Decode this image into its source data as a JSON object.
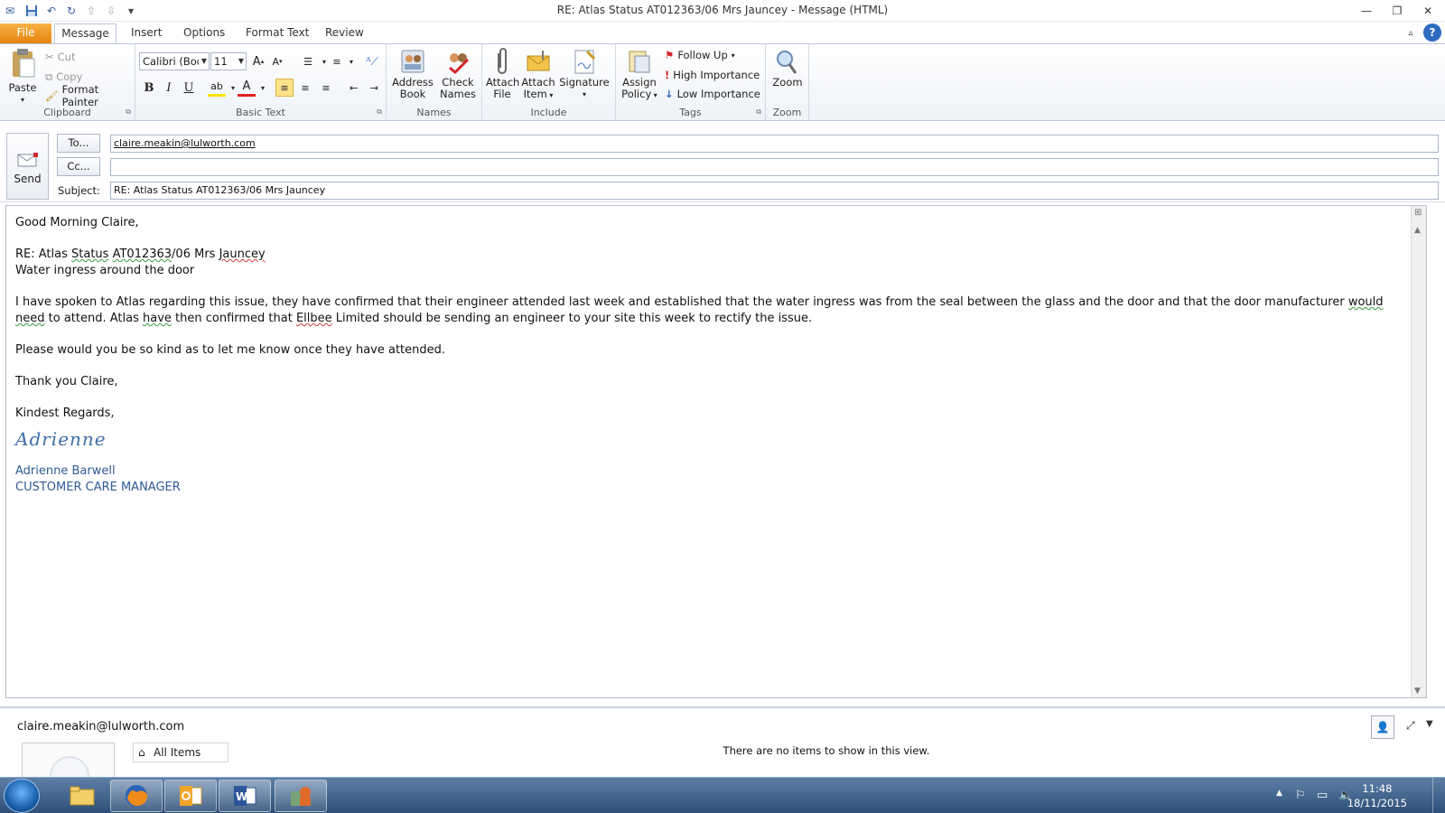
{
  "window": {
    "title": "RE: Atlas Status  AT012363/06  Mrs Jauncey  -  Message (HTML)"
  },
  "tabs": [
    "File",
    "Message",
    "Insert",
    "Options",
    "Format Text",
    "Review"
  ],
  "ribbon": {
    "clipboard": {
      "label": "Clipboard",
      "paste": "Paste",
      "cut": "Cut",
      "copy": "Copy",
      "format_painter": "Format Painter"
    },
    "basic_text": {
      "label": "Basic Text",
      "font": "Calibri (Body)",
      "size": "11"
    },
    "names": {
      "label": "Names",
      "address_book_1": "Address",
      "address_book_2": "Book",
      "check_names_1": "Check",
      "check_names_2": "Names"
    },
    "include": {
      "label": "Include",
      "attach_file_1": "Attach",
      "attach_file_2": "File",
      "attach_item_1": "Attach",
      "attach_item_2": "Item",
      "signature": "Signature"
    },
    "tags": {
      "label": "Tags",
      "assign_1": "Assign",
      "assign_2": "Policy",
      "follow_up": "Follow Up",
      "high": "High Importance",
      "low": "Low Importance"
    },
    "zoom": {
      "label": "Zoom",
      "zoom": "Zoom"
    }
  },
  "header": {
    "send": "Send",
    "to_button": "To...",
    "cc_button": "Cc...",
    "subject_label": "Subject:",
    "to_value": "claire.meakin@lulworth.com",
    "cc_value": "",
    "subject_value": "RE: Atlas Status  AT012363/06  Mrs Jauncey"
  },
  "body": {
    "greeting": "Good Morning Claire,",
    "ref_prefix": "RE: Atlas ",
    "ref_status": "Status",
    "ref_space": " ",
    "ref_code": "AT012363",
    "ref_suffix": "/06  Mrs ",
    "ref_name": "Jauncey",
    "ref_line2": "Water ingress around the door",
    "para1_a": "I have spoken to Atlas regarding this issue, they have confirmed that their engineer attended last week and established that the water ingress was from the seal between the glass and the door and that the door manufacturer ",
    "para1_would": "would  need",
    "para1_b": " to attend.  Atlas ",
    "para1_have": "have",
    "para1_c": " then confirmed that ",
    "para1_ellbee": "Ellbee",
    "para1_d": " Limited should be sending an engineer to your site this week to rectify the issue.",
    "para2": "Please would you be so kind as to let me know once they have attended.",
    "thanks": "Thank you Claire,",
    "regards": "Kindest Regards,",
    "sig_script": "Adrienne",
    "sig_name": "Adrienne Barwell",
    "sig_title": "CUSTOMER CARE MANAGER"
  },
  "people_pane": {
    "address": "claire.meakin@lulworth.com",
    "all_items": "All Items",
    "no_items": "There are no items to show in this view."
  },
  "taskbar": {
    "time": "11:48",
    "date": "18/11/2015"
  },
  "colors": {
    "file_tab": "#e8820c",
    "signature": "#2f5a95",
    "taskbar": "#2f4f78"
  }
}
